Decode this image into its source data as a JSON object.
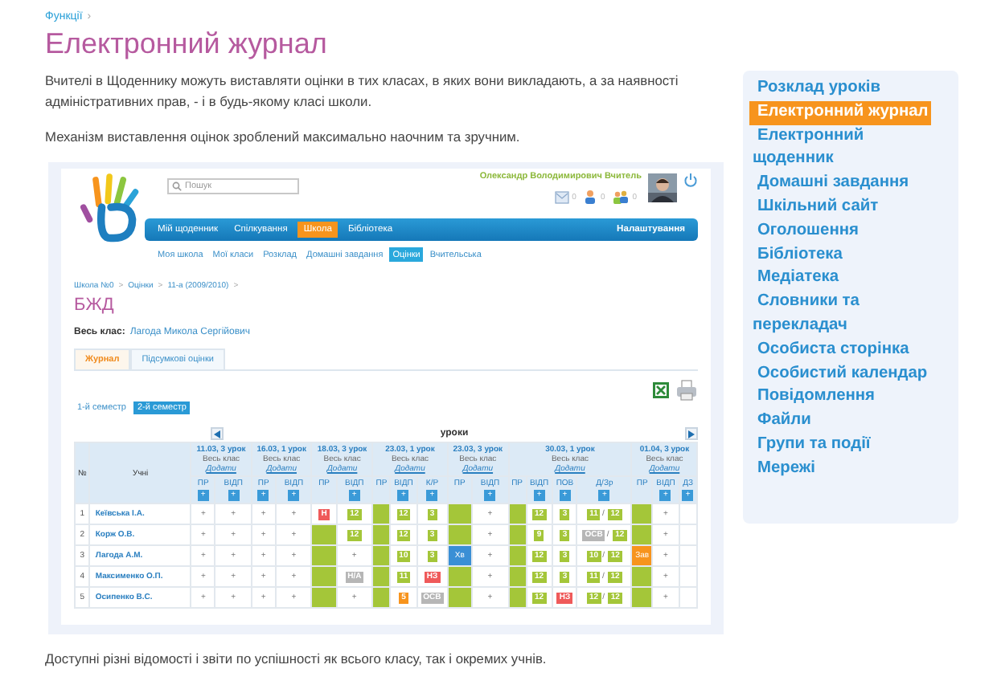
{
  "breadcrumb": {
    "label": "Функції",
    "separator": "›"
  },
  "title": "Електронний журнал",
  "paragraphs": [
    "Вчителі в Щоденнику можуть виставляти оцінки в тих класах, в яких вони викладають, а за наявності адміністративних прав, - і в будь-якому класі школи.",
    "Механізм виставлення оцінок зроблений максимально наочним та зручним."
  ],
  "screenshot": {
    "search": {
      "placeholder": "Пошук"
    },
    "user_name": "Олександр Володимирович Вчитель",
    "counters": [
      {
        "kind": "mail",
        "count": "0"
      },
      {
        "kind": "person",
        "count": "0"
      },
      {
        "kind": "group",
        "count": "0"
      }
    ],
    "nav": [
      {
        "label": "Мій щоденник",
        "selected": false
      },
      {
        "label": "Спілкування",
        "selected": false
      },
      {
        "label": "Школа",
        "selected": true
      },
      {
        "label": "Бібліотека",
        "selected": false
      }
    ],
    "settings": "Налаштування",
    "subnav": [
      {
        "label": "Моя школа",
        "selected": false
      },
      {
        "label": "Мої класи",
        "selected": false
      },
      {
        "label": "Розклад",
        "selected": false
      },
      {
        "label": "Домашні завдання",
        "selected": false
      },
      {
        "label": "Оцінки",
        "selected": true
      },
      {
        "label": "Вчительська",
        "selected": false
      }
    ],
    "breadcrumb": [
      "Школа №0",
      "Оцінки",
      "11-а (2009/2010)"
    ],
    "breadcrumb_separator": ">",
    "title": "БЖД",
    "class_label": "Весь клас:",
    "student": "Лагода Микола Сергійович",
    "tabs": [
      {
        "label": "Журнал",
        "selected": true
      },
      {
        "label": "Підсумкові оцінки",
        "selected": false
      }
    ],
    "semesters": [
      {
        "label": "1-й семестр",
        "selected": false
      },
      {
        "label": "2-й семестр",
        "selected": true
      }
    ],
    "grid": {
      "heading": "уроки",
      "number_header": "№",
      "name_header": "Учні",
      "button_symbol": "+",
      "lessons": [
        {
          "date": "11.03, 3 урок",
          "group": "Весь клас",
          "add": "Додати",
          "columns": [
            {
              "label": "ПР",
              "button": true
            },
            {
              "label": "ВІДП",
              "button": true
            }
          ]
        },
        {
          "date": "16.03, 1 урок",
          "group": "Весь клас",
          "add": "Додати",
          "columns": [
            {
              "label": "ПР",
              "button": true
            },
            {
              "label": "ВІДП",
              "button": true
            }
          ]
        },
        {
          "date": "18.03, 3 урок",
          "group": "Весь клас",
          "add": "Додати",
          "columns": [
            {
              "label": "ПР",
              "button": false
            },
            {
              "label": "ВІДП",
              "button": true
            }
          ]
        },
        {
          "date": "23.03, 1 урок",
          "group": "Весь клас",
          "add": "Додати",
          "columns": [
            {
              "label": "ПР",
              "button": false
            },
            {
              "label": "ВІДП",
              "button": true
            },
            {
              "label": "К/Р",
              "button": true
            }
          ]
        },
        {
          "date": "23.03, 3 урок",
          "group": "Весь клас",
          "add": "Додати",
          "columns": [
            {
              "label": "ПР",
              "button": false
            },
            {
              "label": "ВІДП",
              "button": true
            }
          ]
        },
        {
          "date": "30.03, 1 урок",
          "group": "Весь клас",
          "add": "Додати",
          "columns": [
            {
              "label": "ПР",
              "button": false
            },
            {
              "label": "ВІДП",
              "button": true
            },
            {
              "label": "ПОВ",
              "button": true
            },
            {
              "label": "Д/Зр",
              "button": true
            }
          ]
        },
        {
          "date": "01.04, 3 урок",
          "group": "Весь клас",
          "add": "Додати",
          "columns": [
            {
              "label": "ПР",
              "button": false
            },
            {
              "label": "ВІДП",
              "button": true
            },
            {
              "label": "ДЗ",
              "button": true
            }
          ]
        }
      ],
      "rows": [
        {
          "number": "1",
          "name": "Кеївська І.А.",
          "cells": [
            {
              "kind": "add",
              "text": "+"
            },
            {
              "kind": "add",
              "text": "+"
            },
            {
              "kind": "add",
              "text": "+"
            },
            {
              "kind": "add",
              "text": "+"
            },
            {
              "kind": "mark",
              "text": "Н",
              "color": "#ef5a5a"
            },
            {
              "kind": "mark",
              "text": "12",
              "color": "#a4c639"
            },
            {
              "kind": "filled",
              "color": "#a4c639"
            },
            {
              "kind": "mark",
              "text": "12",
              "color": "#a4c639"
            },
            {
              "kind": "mark",
              "text": "3",
              "color": "#a4c639"
            },
            {
              "kind": "filled",
              "color": "#a4c639"
            },
            {
              "kind": "add",
              "text": "+"
            },
            {
              "kind": "filled",
              "color": "#a4c639"
            },
            {
              "kind": "mark",
              "text": "12",
              "color": "#a4c639"
            },
            {
              "kind": "mark",
              "text": "3",
              "color": "#a4c639"
            },
            {
              "kind": "pair",
              "separator": "/",
              "marks": [
                {
                  "text": "11",
                  "color": "#a4c639"
                },
                {
                  "text": "12",
                  "color": "#a4c639"
                }
              ]
            },
            {
              "kind": "filled",
              "color": "#a4c639"
            },
            {
              "kind": "add",
              "text": "+"
            },
            {
              "kind": "blank"
            }
          ]
        },
        {
          "number": "2",
          "name": "Корж О.В.",
          "cells": [
            {
              "kind": "add",
              "text": "+"
            },
            {
              "kind": "add",
              "text": "+"
            },
            {
              "kind": "add",
              "text": "+"
            },
            {
              "kind": "add",
              "text": "+"
            },
            {
              "kind": "filled",
              "color": "#a4c639"
            },
            {
              "kind": "mark",
              "text": "12",
              "color": "#a4c639"
            },
            {
              "kind": "filled",
              "color": "#a4c639"
            },
            {
              "kind": "mark",
              "text": "12",
              "color": "#a4c639"
            },
            {
              "kind": "mark",
              "text": "3",
              "color": "#a4c639"
            },
            {
              "kind": "filled",
              "color": "#a4c639"
            },
            {
              "kind": "add",
              "text": "+"
            },
            {
              "kind": "filled",
              "color": "#a4c639"
            },
            {
              "kind": "mark",
              "text": "9",
              "color": "#a4c639"
            },
            {
              "kind": "mark",
              "text": "3",
              "color": "#a4c639"
            },
            {
              "kind": "pair",
              "separator": "/",
              "marks": [
                {
                  "text": "ОСВ",
                  "color": "#b6b6b6"
                },
                {
                  "text": "12",
                  "color": "#a4c639"
                }
              ]
            },
            {
              "kind": "filled",
              "color": "#a4c639"
            },
            {
              "kind": "add",
              "text": "+"
            },
            {
              "kind": "blank"
            }
          ]
        },
        {
          "number": "3",
          "name": "Лагода А.М.",
          "cells": [
            {
              "kind": "add",
              "text": "+"
            },
            {
              "kind": "add",
              "text": "+"
            },
            {
              "kind": "add",
              "text": "+"
            },
            {
              "kind": "add",
              "text": "+"
            },
            {
              "kind": "filled",
              "color": "#a4c639"
            },
            {
              "kind": "add",
              "text": "+"
            },
            {
              "kind": "filled",
              "color": "#a4c639"
            },
            {
              "kind": "mark",
              "text": "10",
              "color": "#a4c639"
            },
            {
              "kind": "mark",
              "text": "3",
              "color": "#a4c639"
            },
            {
              "kind": "filled",
              "color": "#3a8fd5",
              "text": "Хв"
            },
            {
              "kind": "add",
              "text": "+"
            },
            {
              "kind": "filled",
              "color": "#a4c639"
            },
            {
              "kind": "mark",
              "text": "12",
              "color": "#a4c639"
            },
            {
              "kind": "mark",
              "text": "3",
              "color": "#a4c639"
            },
            {
              "kind": "pair",
              "separator": "/",
              "marks": [
                {
                  "text": "10",
                  "color": "#a4c639"
                },
                {
                  "text": "12",
                  "color": "#a4c639"
                }
              ]
            },
            {
              "kind": "filled",
              "color": "#f7941d",
              "text": "Зав"
            },
            {
              "kind": "add",
              "text": "+"
            },
            {
              "kind": "blank"
            }
          ]
        },
        {
          "number": "4",
          "name": "Максименко О.П.",
          "cells": [
            {
              "kind": "add",
              "text": "+"
            },
            {
              "kind": "add",
              "text": "+"
            },
            {
              "kind": "add",
              "text": "+"
            },
            {
              "kind": "add",
              "text": "+"
            },
            {
              "kind": "filled",
              "color": "#a4c639"
            },
            {
              "kind": "mark",
              "text": "Н/А",
              "color": "#b6b6b6"
            },
            {
              "kind": "filled",
              "color": "#a4c639"
            },
            {
              "kind": "mark",
              "text": "11",
              "color": "#a4c639"
            },
            {
              "kind": "mark",
              "text": "НЗ",
              "color": "#ef5a5a"
            },
            {
              "kind": "filled",
              "color": "#a4c639"
            },
            {
              "kind": "add",
              "text": "+"
            },
            {
              "kind": "filled",
              "color": "#a4c639"
            },
            {
              "kind": "mark",
              "text": "12",
              "color": "#a4c639"
            },
            {
              "kind": "mark",
              "text": "3",
              "color": "#a4c639"
            },
            {
              "kind": "pair",
              "separator": "/",
              "marks": [
                {
                  "text": "11",
                  "color": "#a4c639"
                },
                {
                  "text": "12",
                  "color": "#a4c639"
                }
              ]
            },
            {
              "kind": "filled",
              "color": "#a4c639"
            },
            {
              "kind": "add",
              "text": "+"
            },
            {
              "kind": "blank"
            }
          ]
        },
        {
          "number": "5",
          "name": "Осипенко В.С.",
          "cells": [
            {
              "kind": "add",
              "text": "+"
            },
            {
              "kind": "add",
              "text": "+"
            },
            {
              "kind": "add",
              "text": "+"
            },
            {
              "kind": "add",
              "text": "+"
            },
            {
              "kind": "filled",
              "color": "#a4c639"
            },
            {
              "kind": "add",
              "text": "+"
            },
            {
              "kind": "filled",
              "color": "#a4c639"
            },
            {
              "kind": "mark",
              "text": "5",
              "color": "#f7941d"
            },
            {
              "kind": "mark",
              "text": "ОСВ",
              "color": "#b6b6b6"
            },
            {
              "kind": "filled",
              "color": "#a4c639"
            },
            {
              "kind": "add",
              "text": "+"
            },
            {
              "kind": "filled",
              "color": "#a4c639"
            },
            {
              "kind": "mark",
              "text": "12",
              "color": "#a4c639"
            },
            {
              "kind": "mark",
              "text": "НЗ",
              "color": "#ef5a5a"
            },
            {
              "kind": "pair",
              "separator": "/",
              "marks": [
                {
                  "text": "12",
                  "color": "#a4c639"
                },
                {
                  "text": "12",
                  "color": "#a4c639"
                }
              ]
            },
            {
              "kind": "filled",
              "color": "#a4c639"
            },
            {
              "kind": "add",
              "text": "+"
            },
            {
              "kind": "blank"
            }
          ]
        }
      ]
    }
  },
  "closing": "Доступні різні відомості і звіти по успішності як всього класу, так і окремих учнів.",
  "sidebar": [
    {
      "label": "Розклад уроків",
      "selected": false
    },
    {
      "label": "Електронний журнал",
      "selected": true
    },
    {
      "label": "Електронний щоденник",
      "selected": false
    },
    {
      "label": "Домашні завдання",
      "selected": false
    },
    {
      "label": "Шкільний сайт",
      "selected": false
    },
    {
      "label": "Оголошення",
      "selected": false
    },
    {
      "label": "Бібліотека",
      "selected": false
    },
    {
      "label": "Медіатека",
      "selected": false
    },
    {
      "label": "Словники та перекладач",
      "selected": false
    },
    {
      "label": "Особиста сторінка",
      "selected": false
    },
    {
      "label": "Особистий календар",
      "selected": false
    },
    {
      "label": "Повідомлення",
      "selected": false
    },
    {
      "label": "Файли",
      "selected": false
    },
    {
      "label": "Групи та події",
      "selected": false
    },
    {
      "label": "Мережі",
      "selected": false
    }
  ]
}
